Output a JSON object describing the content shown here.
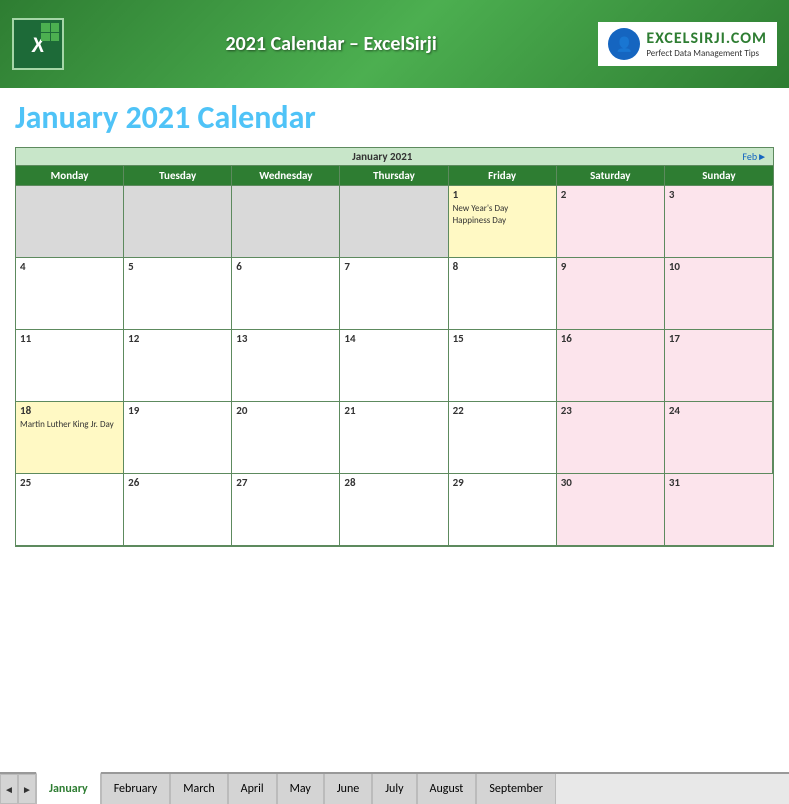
{
  "header": {
    "title": "2021 Calendar – ExcelSirji",
    "brand_name_part1": "EXCEL",
    "brand_name_part2": "SIRJI",
    "brand_domain": ".COM",
    "brand_tagline": "Perfect Data Management Tips"
  },
  "page_title": "January 2021 Calendar",
  "calendar": {
    "month_label": "January 2021",
    "feb_link": "Feb►",
    "days": [
      "Monday",
      "Tuesday",
      "Wednesday",
      "Thursday",
      "Friday",
      "Saturday",
      "Sunday"
    ],
    "weeks": [
      [
        {
          "date": "",
          "empty": true
        },
        {
          "date": "",
          "empty": true
        },
        {
          "date": "",
          "empty": true
        },
        {
          "date": "",
          "empty": true
        },
        {
          "date": "1",
          "holiday": true,
          "events": [
            "New Year's Day",
            "Happiness Day"
          ]
        },
        {
          "date": "2",
          "weekend": true
        },
        {
          "date": "3",
          "weekend": true
        }
      ],
      [
        {
          "date": "4"
        },
        {
          "date": "5"
        },
        {
          "date": "6"
        },
        {
          "date": "7"
        },
        {
          "date": "8"
        },
        {
          "date": "9",
          "weekend": true
        },
        {
          "date": "10",
          "weekend": true
        }
      ],
      [
        {
          "date": "11"
        },
        {
          "date": "12"
        },
        {
          "date": "13"
        },
        {
          "date": "14"
        },
        {
          "date": "15"
        },
        {
          "date": "16",
          "weekend": true
        },
        {
          "date": "17",
          "weekend": true
        }
      ],
      [
        {
          "date": "18",
          "mlk": true,
          "events": [
            "Martin Luther King Jr. Day"
          ]
        },
        {
          "date": "19"
        },
        {
          "date": "20"
        },
        {
          "date": "21"
        },
        {
          "date": "22"
        },
        {
          "date": "23",
          "weekend": true
        },
        {
          "date": "24",
          "weekend": true
        }
      ],
      [
        {
          "date": "25"
        },
        {
          "date": "26"
        },
        {
          "date": "27"
        },
        {
          "date": "28"
        },
        {
          "date": "29"
        },
        {
          "date": "30",
          "weekend": true
        },
        {
          "date": "31",
          "weekend": true
        }
      ]
    ]
  },
  "tabs": {
    "items": [
      "January",
      "February",
      "March",
      "April",
      "May",
      "June",
      "July",
      "August",
      "September"
    ],
    "active": "January"
  },
  "nav": {
    "prev": "◄",
    "next": "►"
  }
}
